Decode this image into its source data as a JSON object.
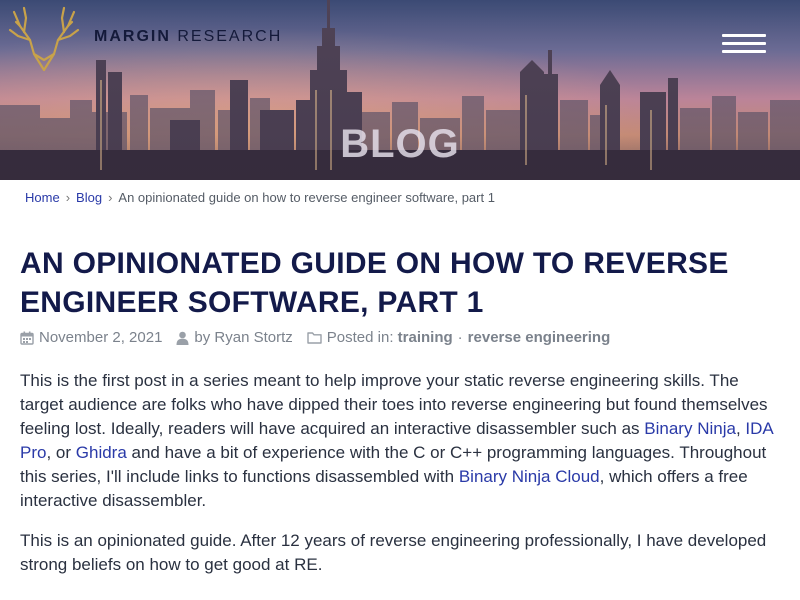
{
  "header": {
    "logo": {
      "word1": "MARGIN",
      "word2": "RESEARCH",
      "icon": "stag-antlers-icon"
    },
    "menu_icon": "hamburger-menu-icon",
    "hero_title": "BLOG"
  },
  "breadcrumb": {
    "home": "Home",
    "blog": "Blog",
    "current": "An opinionated guide on how to reverse engineer software, part 1",
    "separator": "›"
  },
  "post": {
    "title": "AN OPINIONATED GUIDE ON HOW TO REVERSE ENGINEER SOFTWARE, PART 1",
    "date": "November 2, 2021",
    "author": "by Ryan Stortz",
    "posted_in_label": "Posted in:",
    "tags": [
      "training",
      "reverse engineering"
    ],
    "tag_separator": "·",
    "paragraph1": {
      "t1": "This is the first post in a series meant to help improve your static reverse engineering skills. The target audience are folks who have dipped their toes into reverse engineering but found themselves feeling lost. Ideally, readers will have acquired an interactive disassembler such as ",
      "link1": "Binary Ninja",
      "t2": ", ",
      "link2": "IDA Pro",
      "t3": ", or ",
      "link3": "Ghidra",
      "t4": " and have a bit of experience with the C or C++ programming languages. Throughout this series, I'll include links to functions disassembled with ",
      "link4": "Binary Ninja Cloud",
      "t5": ", which offers a free interactive disassembler."
    },
    "paragraph2": "This is an opinionated guide. After 12 years of reverse engineering professionally, I have developed strong beliefs on how to get good at RE."
  },
  "colors": {
    "title": "#131a4a",
    "link": "#2a3aa8",
    "meta": "#7b828c",
    "body_text": "#2a3140",
    "logo_gold": "#c8a24a"
  }
}
